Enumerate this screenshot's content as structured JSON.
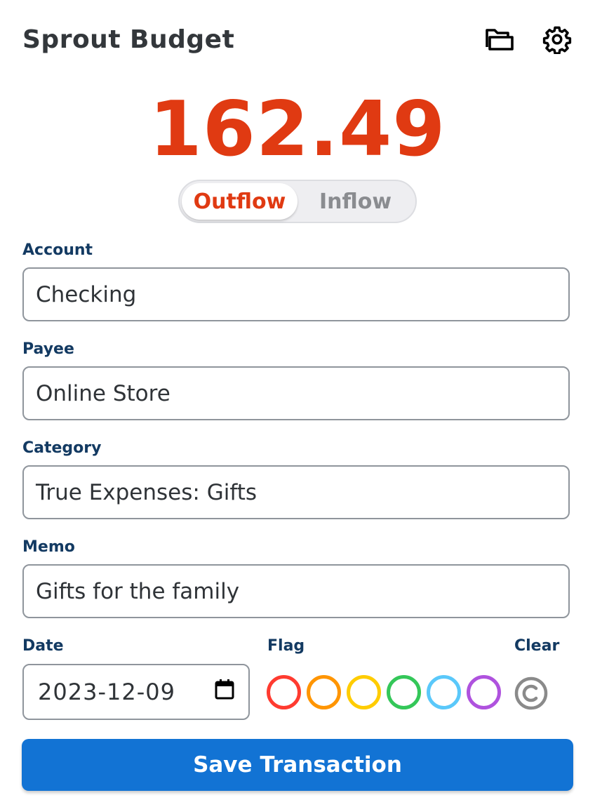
{
  "app": {
    "title": "Sprout Budget"
  },
  "header": {
    "icons": [
      "folder-icon",
      "gear-icon"
    ]
  },
  "amount": {
    "value": "162.49"
  },
  "flow": {
    "options": [
      "Outflow",
      "Inflow"
    ],
    "selected": "Outflow"
  },
  "fields": {
    "account": {
      "label": "Account",
      "value": "Checking"
    },
    "payee": {
      "label": "Payee",
      "value": "Online Store"
    },
    "category": {
      "label": "Category",
      "value": "True Expenses: Gifts"
    },
    "memo": {
      "label": "Memo",
      "value": "Gifts for the family"
    },
    "date": {
      "label": "Date",
      "value": "2023-12-09",
      "icon": "calendar-icon"
    }
  },
  "flag": {
    "label": "Flag",
    "colors": [
      {
        "name": "red",
        "hex": "#ff3b30"
      },
      {
        "name": "orange",
        "hex": "#ff9500"
      },
      {
        "name": "yellow",
        "hex": "#ffcc00"
      },
      {
        "name": "green",
        "hex": "#34c759"
      },
      {
        "name": "blue",
        "hex": "#5ac8fa"
      },
      {
        "name": "purple",
        "hex": "#af52de"
      }
    ]
  },
  "clear": {
    "label": "Clear",
    "icon": "copyright-icon",
    "color": "#8a8a8a"
  },
  "save": {
    "label": "Save Transaction"
  },
  "colors": {
    "amount": "#e03a12",
    "outflow": "#e03a12",
    "label": "#133a62",
    "primary": "#1273d4"
  }
}
